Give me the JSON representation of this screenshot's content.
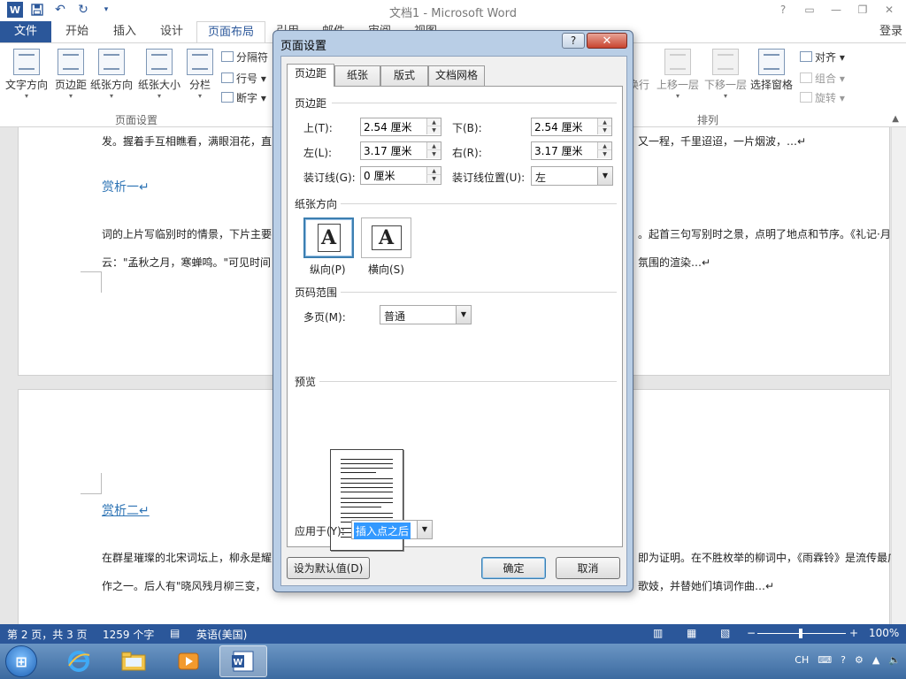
{
  "window": {
    "title": "文档1 - Microsoft Word",
    "logo": "W",
    "qat": {
      "undo": "↶",
      "redo": "↻"
    },
    "controls": {
      "help": "?",
      "ribbon_options": "▭",
      "minimize": "—",
      "restore": "❐",
      "close": "✕"
    }
  },
  "ribbon_tabs": [
    {
      "label": "文件"
    },
    {
      "label": "开始"
    },
    {
      "label": "插入"
    },
    {
      "label": "设计"
    },
    {
      "label": "页面布局"
    },
    {
      "label": "引用"
    },
    {
      "label": "邮件"
    },
    {
      "label": "审阅"
    },
    {
      "label": "视图"
    }
  ],
  "login": "登录",
  "ribbon": {
    "page_setup_group": "页面设置",
    "arrange_group": "排列",
    "buttons": {
      "text_direction": "文字方向",
      "margins": "页边距",
      "orientation": "纸张方向",
      "size": "纸张大小",
      "columns": "分栏",
      "breaks": "分隔符",
      "line_numbers": "行号",
      "hyphenation": "断字",
      "wrap": "换行",
      "bring_forward": "上移一层",
      "send_backward": "下移一层",
      "selection_pane": "选择窗格",
      "align": "对齐",
      "group": "组合",
      "rotate": "旋转"
    }
  },
  "document": {
    "page1": {
      "line1_left": "发。握着手互相瞧看，满眼泪花，直",
      "line1_right": "又一程，千里迢迢，一片烟波，…↵",
      "heading": "赏析一↵",
      "para1_left": "词的上片写临别时的情景，下片主要",
      "para1_right": "。起首三句写别时之景，点明了地点和节序。《礼记·月令",
      "para2_left": "云：\"孟秋之月，寒蝉鸣。\"可见时间",
      "para2_right": "氛围的渲染…↵"
    },
    "page2": {
      "heading": "赏析二↵",
      "para1_left": "在群星璀璨的北宋词坛上，柳永是耀",
      "para1_right": "即为证明。在不胜枚举的柳词中，《雨霖铃》是流传最广",
      "para2_left": "作之一。后人有\"晓风残月柳三变，",
      "para2_right": "歌妓，并替她们填词作曲…↵"
    }
  },
  "statusbar": {
    "page": "第 2 页，共 3 页",
    "words": "1259 个字",
    "language": "英语(美国)",
    "zoom": "100%",
    "zoom_minus": "−",
    "zoom_plus": "+"
  },
  "taskbar": {
    "start": "⊞",
    "tray_lang": "CH"
  },
  "dialog": {
    "title": "页面设置",
    "help": "?",
    "close": "✕",
    "tabs": [
      {
        "label": "页边距"
      },
      {
        "label": "纸张"
      },
      {
        "label": "版式"
      },
      {
        "label": "文档网格"
      }
    ],
    "margins_section": "页边距",
    "top_label": "上(T):",
    "top_value": "2.54 厘米",
    "bottom_label": "下(B):",
    "bottom_value": "2.54 厘米",
    "left_label": "左(L):",
    "left_value": "3.17 厘米",
    "right_label": "右(R):",
    "right_value": "3.17 厘米",
    "gutter_label": "装订线(G):",
    "gutter_value": "0 厘米",
    "gutter_pos_label": "装订线位置(U):",
    "gutter_pos_value": "左",
    "orientation_section": "纸张方向",
    "portrait": "纵向(P)",
    "landscape": "横向(S)",
    "orientation_glyph": "A",
    "pages_section": "页码范围",
    "multiple_pages_label": "多页(M):",
    "multiple_pages_value": "普通",
    "preview_section": "预览",
    "apply_to_label": "应用于(Y):",
    "apply_to_value": "插入点之后",
    "set_default": "设为默认值(D)",
    "ok": "确定",
    "cancel": "取消"
  },
  "colors": {
    "accent": "#2b579a",
    "heading": "#2e74b5",
    "selection": "#3399ff"
  }
}
